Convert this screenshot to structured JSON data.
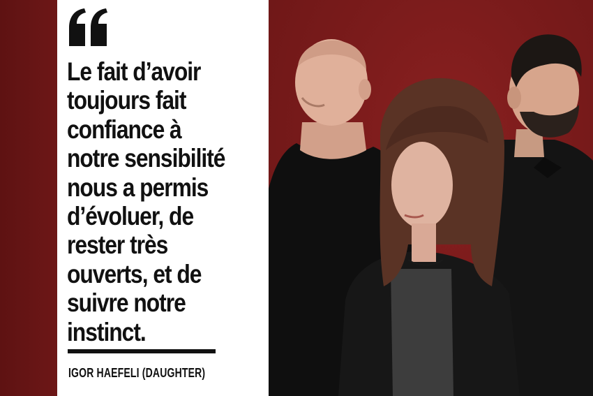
{
  "quote": {
    "text": "Le fait d’avoir\ntoujours fait\nconfiance à\nnotre sensibilité\nnous a permis\nd’évoluer, de\nrester très\nouverts, et de\nsuivre notre\ninstinct.",
    "attribution": "IGOR HAEFELI (DAUGHTER)"
  },
  "colors": {
    "background_red": "#6e1818",
    "panel": "#ffffff",
    "text": "#111111"
  },
  "icons": {
    "quote_mark": "opening-quote-icon"
  }
}
